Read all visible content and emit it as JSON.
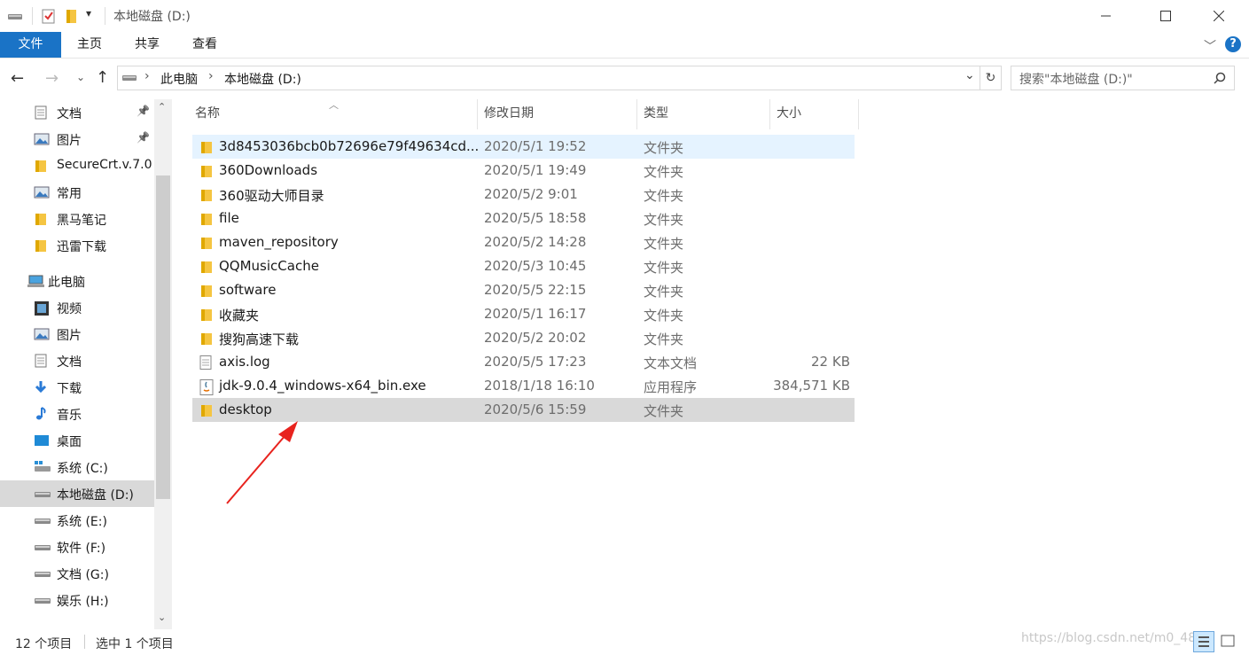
{
  "window": {
    "title": "本地磁盘 (D:)",
    "minimize": "—",
    "maximize": "☐",
    "close": "✕"
  },
  "ribbon": {
    "tabs": [
      "文件",
      "主页",
      "共享",
      "查看"
    ],
    "help": "?"
  },
  "nav": {
    "breadcrumb": [
      "此电脑",
      "本地磁盘 (D:)"
    ],
    "search_placeholder": "搜索\"本地磁盘 (D:)\""
  },
  "sidebar": {
    "items": [
      {
        "label": "文档",
        "icon": "document-icon",
        "pinned": true
      },
      {
        "label": "图片",
        "icon": "picture-icon",
        "pinned": true
      },
      {
        "label": "SecureCrt.v.7.0",
        "icon": "folder-icon"
      },
      {
        "label": "常用",
        "icon": "picture-icon"
      },
      {
        "label": "黑马笔记",
        "icon": "folder-icon"
      },
      {
        "label": "迅雷下载",
        "icon": "folder-icon"
      },
      {
        "label": "此电脑",
        "icon": "computer-icon"
      },
      {
        "label": "视频",
        "icon": "video-icon"
      },
      {
        "label": "图片",
        "icon": "picture-icon"
      },
      {
        "label": "文档",
        "icon": "document-icon"
      },
      {
        "label": "下载",
        "icon": "download-icon"
      },
      {
        "label": "音乐",
        "icon": "music-icon"
      },
      {
        "label": "桌面",
        "icon": "desktop-icon"
      },
      {
        "label": "系统 (C:)",
        "icon": "windows-drive-icon"
      },
      {
        "label": "本地磁盘 (D:)",
        "icon": "drive-icon",
        "selected": true
      },
      {
        "label": "系统 (E:)",
        "icon": "drive-icon"
      },
      {
        "label": "软件 (F:)",
        "icon": "drive-icon"
      },
      {
        "label": "文档 (G:)",
        "icon": "drive-icon"
      },
      {
        "label": "娱乐 (H:)",
        "icon": "drive-icon"
      }
    ]
  },
  "columns": [
    "名称",
    "修改日期",
    "类型",
    "大小"
  ],
  "files": [
    {
      "name": "3d8453036bcb0b72696e79f49634cd...",
      "date": "2020/5/1 19:52",
      "type": "文件夹",
      "size": "",
      "icon": "folder-icon",
      "state": "hover"
    },
    {
      "name": "360Downloads",
      "date": "2020/5/1 19:49",
      "type": "文件夹",
      "size": "",
      "icon": "folder-icon"
    },
    {
      "name": "360驱动大师目录",
      "date": "2020/5/2 9:01",
      "type": "文件夹",
      "size": "",
      "icon": "folder-icon"
    },
    {
      "name": "file",
      "date": "2020/5/5 18:58",
      "type": "文件夹",
      "size": "",
      "icon": "folder-icon"
    },
    {
      "name": "maven_repository",
      "date": "2020/5/2 14:28",
      "type": "文件夹",
      "size": "",
      "icon": "folder-icon"
    },
    {
      "name": "QQMusicCache",
      "date": "2020/5/3 10:45",
      "type": "文件夹",
      "size": "",
      "icon": "folder-icon"
    },
    {
      "name": "software",
      "date": "2020/5/5 22:15",
      "type": "文件夹",
      "size": "",
      "icon": "folder-icon"
    },
    {
      "name": "收藏夹",
      "date": "2020/5/1 16:17",
      "type": "文件夹",
      "size": "",
      "icon": "folder-icon"
    },
    {
      "name": "搜狗高速下载",
      "date": "2020/5/2 20:02",
      "type": "文件夹",
      "size": "",
      "icon": "folder-icon"
    },
    {
      "name": "axis.log",
      "date": "2020/5/5 17:23",
      "type": "文本文档",
      "size": "22 KB",
      "icon": "text-file-icon"
    },
    {
      "name": "jdk-9.0.4_windows-x64_bin.exe",
      "date": "2018/1/18 16:10",
      "type": "应用程序",
      "size": "384,571 KB",
      "icon": "java-exe-icon"
    },
    {
      "name": "desktop",
      "date": "2020/5/6 15:59",
      "type": "文件夹",
      "size": "",
      "icon": "folder-icon",
      "state": "selected"
    }
  ],
  "status": {
    "count": "12 个项目",
    "selected": "选中 1 个项目",
    "watermark": "https://blog.csdn.net/m0_48"
  },
  "colors": {
    "accent": "#1a73c6",
    "folder": "#f5c542",
    "selected_row": "#d9d9d9",
    "hover_row": "#e5f3ff",
    "arrow": "#e8231e"
  }
}
